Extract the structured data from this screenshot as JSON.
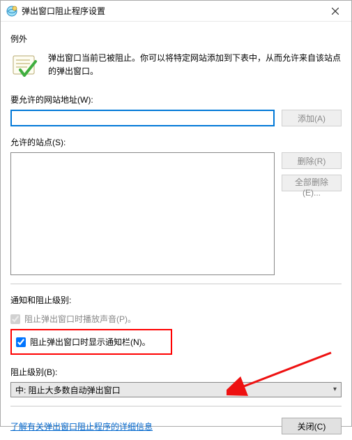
{
  "titlebar": {
    "title": "弹出窗口阻止程序设置"
  },
  "exceptions": {
    "heading": "例外",
    "intro": "弹出窗口当前已被阻止。你可以将特定网站添加到下表中，从而允许来自该站点的弹出窗口。",
    "address_label": "要允许的网站地址(W):",
    "address_value": "",
    "add_btn": "添加(A)",
    "allowed_label": "允许的站点(S):",
    "allowed_items": [],
    "remove_btn": "删除(R)",
    "remove_all_btn": "全部删除(E)..."
  },
  "notify": {
    "heading": "通知和阻止级别:",
    "cb_sound_checked": true,
    "cb_sound_label": "阻止弹出窗口时播放声音(P)。",
    "cb_sound_disabled": true,
    "cb_notify_checked": true,
    "cb_notify_label": "阻止弹出窗口时显示通知栏(N)。",
    "level_label": "阻止级别(B):",
    "level_value": "中: 阻止大多数自动弹出窗口"
  },
  "footer": {
    "link": "了解有关弹出窗口阻止程序的详细信息",
    "close_btn": "关闭(C)"
  }
}
